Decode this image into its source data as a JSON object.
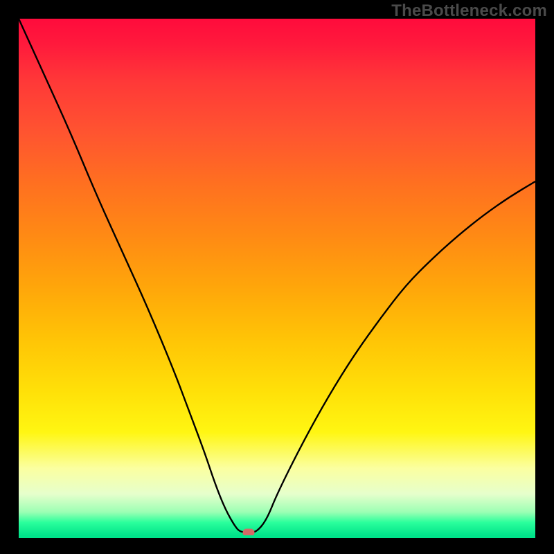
{
  "watermark": "TheBottleneck.com",
  "colors": {
    "frame": "#000000",
    "marker": "#d46a66",
    "curve": "#000000"
  },
  "chart_data": {
    "type": "line",
    "title": "",
    "xlabel": "",
    "ylabel": "",
    "xlim": [
      0,
      100
    ],
    "ylim": [
      0,
      100
    ],
    "series": [
      {
        "name": "bottleneck-curve",
        "x": [
          0,
          5,
          10,
          15,
          20,
          25,
          30,
          33,
          36,
          38,
          40,
          42,
          43,
          44.5,
          46,
          48,
          50,
          55,
          60,
          65,
          70,
          75,
          80,
          85,
          90,
          95,
          100
        ],
        "values": [
          100,
          89,
          78,
          66,
          55,
          44,
          32,
          24,
          16,
          10,
          5,
          1.5,
          0.6,
          0.6,
          0.6,
          3,
          8,
          18,
          27,
          35,
          42,
          48.5,
          53.5,
          58,
          62,
          65.5,
          68.5
        ]
      }
    ],
    "marker": {
      "x": 44.5,
      "y": 0.6
    }
  }
}
